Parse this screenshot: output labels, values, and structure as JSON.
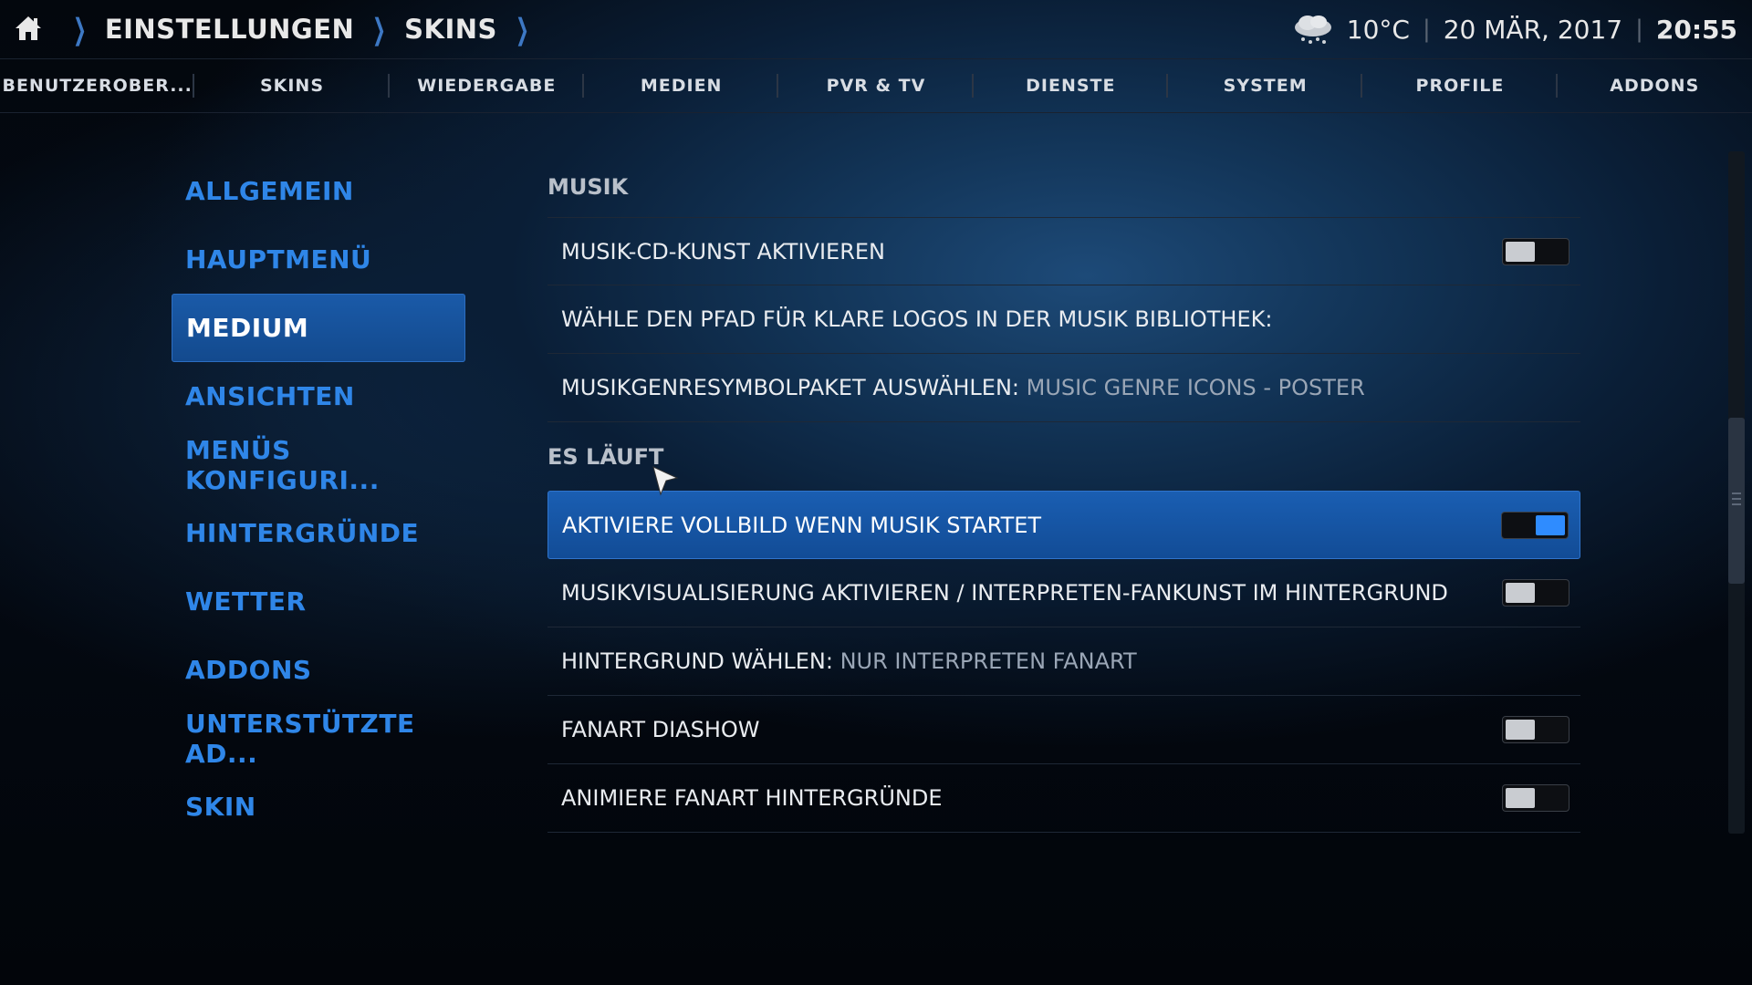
{
  "header": {
    "crumbs": [
      "EINSTELLUNGEN",
      "SKINS"
    ],
    "temperature": "10°C",
    "date": "20 MÄR, 2017",
    "time": "20:55",
    "weather_icon": "cloud-snow-icon"
  },
  "tabs": [
    "BENUTZEROBER...",
    "SKINS",
    "WIEDERGABE",
    "MEDIEN",
    "PVR & TV",
    "DIENSTE",
    "SYSTEM",
    "PROFILE",
    "ADDONS"
  ],
  "menu": {
    "items": [
      "ALLGEMEIN",
      "HAUPTMENÜ",
      "MEDIUM",
      "ANSICHTEN",
      "MENÜS KONFIGURI...",
      "HINTERGRÜNDE",
      "WETTER",
      "ADDONS",
      "UNTERSTÜTZTE AD...",
      "SKIN"
    ],
    "active_index": 2
  },
  "settings": {
    "group_musik": "MUSIK",
    "item_cd_art": "MUSIK-CD-KUNST AKTIVIEREN",
    "item_clearlogo": "WÄHLE DEN PFAD FÜR KLARE LOGOS IN DER MUSIK BIBLIOTHEK:",
    "item_genre_label": "MUSIKGENRESYMBOLPAKET AUSWÄHLEN:",
    "item_genre_value": "MUSIC GENRE ICONS - POSTER",
    "group_playing": "ES LÄUFT",
    "item_fullscreen": "AKTIVIERE VOLLBILD WENN MUSIK STARTET",
    "item_visualisation": "MUSIKVISUALISIERUNG AKTIVIEREN / INTERPRETEN-FANKUNST IM HINTERGRUND",
    "item_background_label": "HINTERGRUND WÄHLEN:",
    "item_background_value": "NUR INTERPRETEN FANART",
    "item_fanart_slideshow": "FANART DIASHOW",
    "item_animate_fanart": "ANIMIERE FANART HINTERGRÜNDE"
  },
  "toggles": {
    "cd_art": false,
    "fullscreen": true,
    "visualisation": false,
    "fanart_slideshow": false,
    "animate_fanart": false
  },
  "colors": {
    "accent": "#2f86e8",
    "focus": "#1a5eb2",
    "toggle_on": "#2f8cff"
  }
}
